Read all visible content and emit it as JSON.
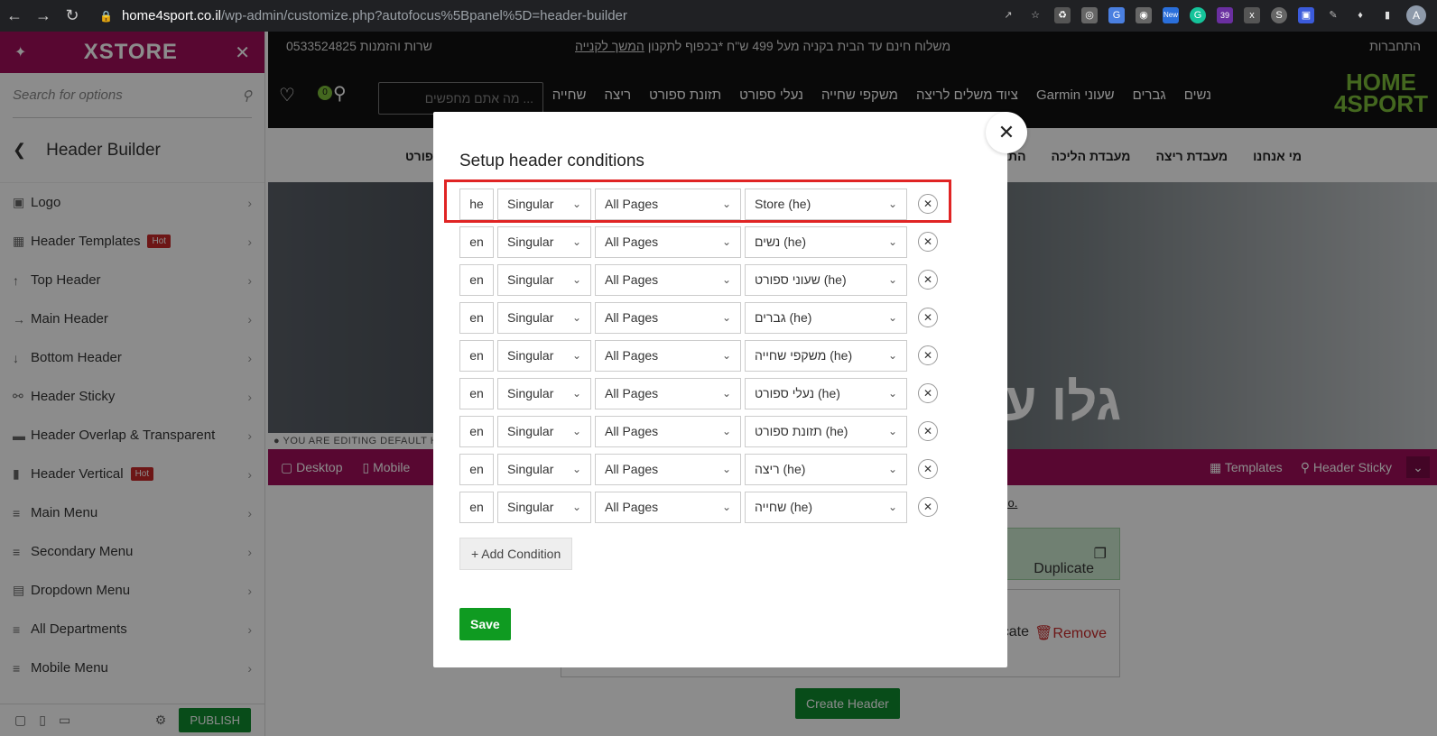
{
  "browser": {
    "url_domain": "home4sport.co.il",
    "url_path": "/wp-admin/customize.php?autofocus%5Bpanel%5D=header-builder",
    "ext_badge_new": "New",
    "ext_badge_count": "39",
    "avatar_letter": "A"
  },
  "sidebar": {
    "brand": "XSTORE",
    "search_placeholder": "Search for options",
    "section_title": "Header Builder",
    "items": [
      {
        "label": "Logo",
        "icon": "image-icon"
      },
      {
        "label": "Header Templates",
        "icon": "grid-icon",
        "badge": "Hot"
      },
      {
        "label": "Top Header",
        "icon": "arrow-up-icon"
      },
      {
        "label": "Main Header",
        "icon": "arrow-right-icon"
      },
      {
        "label": "Bottom Header",
        "icon": "arrow-down-icon"
      },
      {
        "label": "Header Sticky",
        "icon": "link-icon"
      },
      {
        "label": "Header Overlap & Transparent",
        "icon": "card-icon"
      },
      {
        "label": "Header Vertical",
        "icon": "book-icon",
        "badge": "Hot"
      },
      {
        "label": "Main Menu",
        "icon": "menu-icon"
      },
      {
        "label": "Secondary Menu",
        "icon": "menu-icon"
      },
      {
        "label": "Dropdown Menu",
        "icon": "dropdown-icon"
      },
      {
        "label": "All Departments",
        "icon": "menu-icon"
      },
      {
        "label": "Mobile Menu",
        "icon": "menu-icon"
      }
    ],
    "publish_label": "PUBLISH"
  },
  "site": {
    "topbar_phone": "0533524825 שרות והזמנות",
    "topbar_promo": "משלוח חינם עד הבית בקניה מעל 499 ש\"ח *בכפוף לתקנון",
    "topbar_continue": "המשך לקנייה",
    "topbar_login": "התחברות",
    "search_placeholder": "מה אתם מחפשים ...",
    "cart_count": "0",
    "logo_line1": "HOME",
    "logo_line2": "4SPORT",
    "menu": [
      "נשים",
      "גברים",
      "שעוני Garmin",
      "ציוד משלים לריצה",
      "משקפי שחייה",
      "נעלי ספורט",
      "תזונת ספורט",
      "ריצה",
      "שחייה"
    ],
    "subnav": [
      "מי אנחנו",
      "מעבדת ריצה",
      "מעבדת הליכה",
      "התאמה"
    ],
    "subnav_left": "פורט",
    "hero_text": "גלו עו",
    "editing_notice": "YOU ARE EDITING DEFAULT H",
    "builder_left": [
      "Desktop",
      "Mobile"
    ],
    "builder_right": [
      "Templates",
      "Header Sticky"
    ],
    "video_link": "deo.",
    "duplicate_label": "Duplicate",
    "duplicate_label2": "plicate",
    "remove_label": "Remove",
    "create_header_label": "Create Header"
  },
  "modal": {
    "title": "Setup header conditions",
    "conditions": [
      {
        "lang": "he",
        "type": "Singular",
        "scope": "All Pages",
        "target": "Store (he)"
      },
      {
        "lang": "en",
        "type": "Singular",
        "scope": "All Pages",
        "target": "נשים (he)"
      },
      {
        "lang": "en",
        "type": "Singular",
        "scope": "All Pages",
        "target": "שעוני ספורט (he)"
      },
      {
        "lang": "en",
        "type": "Singular",
        "scope": "All Pages",
        "target": "גברים (he)"
      },
      {
        "lang": "en",
        "type": "Singular",
        "scope": "All Pages",
        "target": "משקפי שחייה (he)"
      },
      {
        "lang": "en",
        "type": "Singular",
        "scope": "All Pages",
        "target": "נעלי ספורט (he)"
      },
      {
        "lang": "en",
        "type": "Singular",
        "scope": "All Pages",
        "target": "תזונת ספורט (he)"
      },
      {
        "lang": "en",
        "type": "Singular",
        "scope": "All Pages",
        "target": "ריצה (he)"
      },
      {
        "lang": "en",
        "type": "Singular",
        "scope": "All Pages",
        "target": "שחייה (he)"
      }
    ],
    "add_condition_label": "Add Condition",
    "save_label": "Save"
  },
  "colors": {
    "brand_magenta": "#a00e5a",
    "save_green": "#0f9b21",
    "highlight_red": "#e02424"
  }
}
